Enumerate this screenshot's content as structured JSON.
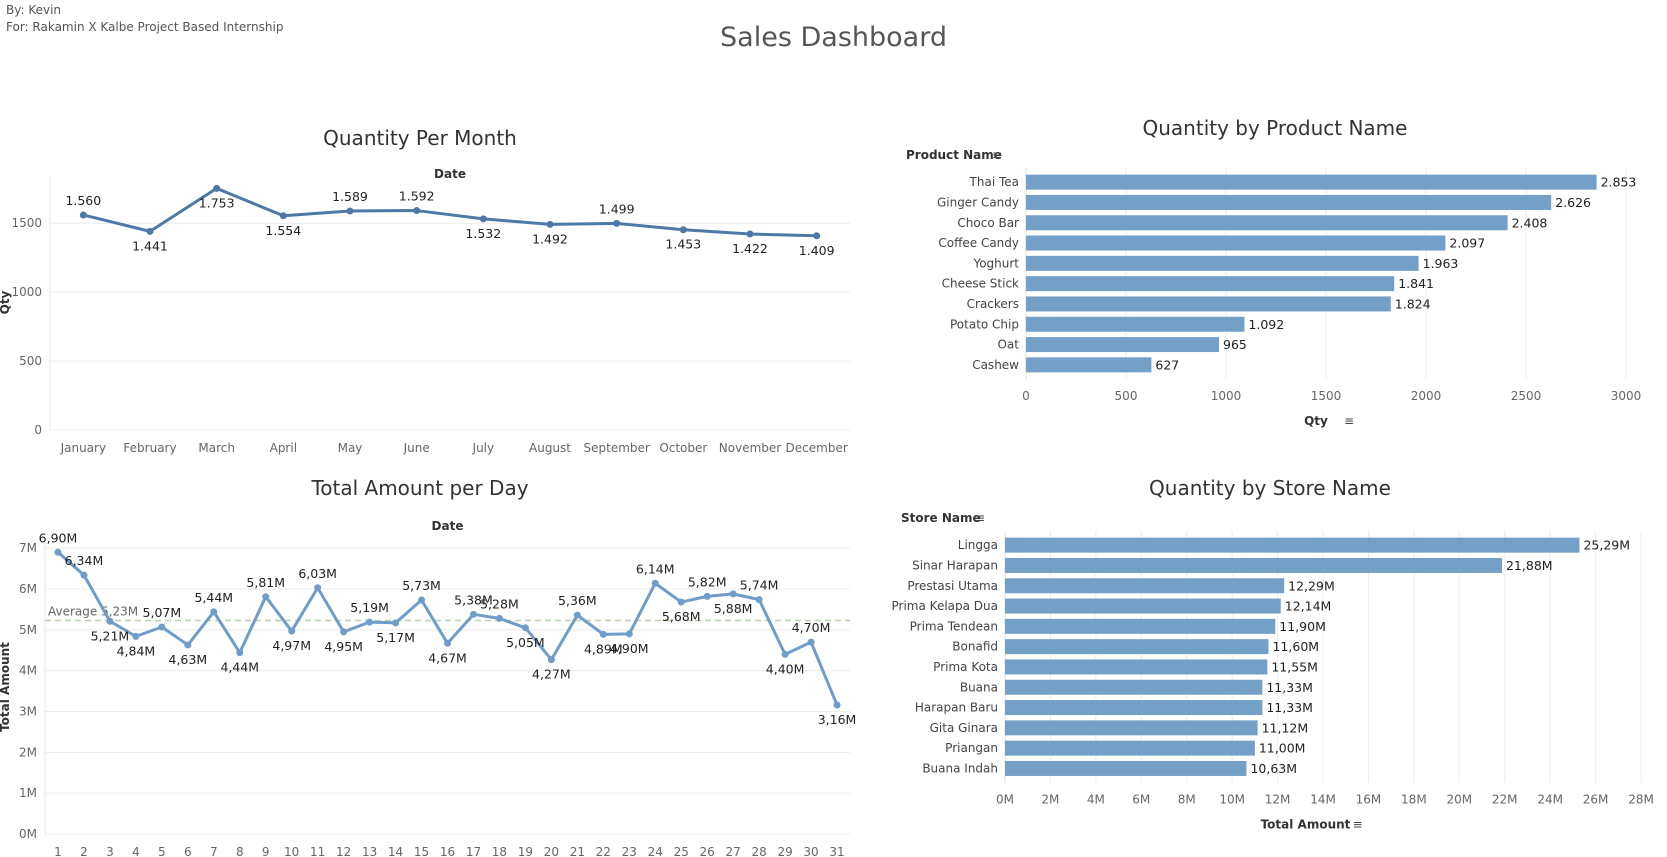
{
  "header": {
    "credit_by": "By: Kevin",
    "credit_for": "For: Rakamin X Kalbe Project Based Internship",
    "title": "Sales Dashboard"
  },
  "colors": {
    "month_line": "#4e79a7",
    "day_line": "#6f9cc9",
    "bar": "#74a0c8",
    "average_line": "#b9d2b2",
    "grid": "#ececec",
    "axis_text": "#666666"
  },
  "chart_data": [
    {
      "id": "qty_month",
      "type": "line",
      "title": "Quantity Per Month",
      "column_header": "Date",
      "ylabel": "Qty",
      "categories": [
        "January",
        "February",
        "March",
        "April",
        "May",
        "June",
        "July",
        "August",
        "September",
        "October",
        "November",
        "December"
      ],
      "values": [
        1560,
        1441,
        1753,
        1554,
        1589,
        1592,
        1532,
        1492,
        1499,
        1453,
        1422,
        1409
      ],
      "labels": [
        "1.560",
        "1.441",
        "1.753",
        "1.554",
        "1.589",
        "1.592",
        "1.532",
        "1.492",
        "1.499",
        "1.453",
        "1.422",
        "1.409"
      ],
      "y_ticks": [
        0,
        500,
        1000,
        1500
      ],
      "ylim": [
        0,
        1850
      ],
      "grid": true
    },
    {
      "id": "qty_product",
      "type": "bar",
      "orientation": "horizontal",
      "title": "Quantity by Product Name",
      "row_header": "Product Name",
      "xlabel": "Qty",
      "categories": [
        "Thai Tea",
        "Ginger Candy",
        "Choco Bar",
        "Coffee Candy",
        "Yoghurt",
        "Cheese Stick",
        "Crackers",
        "Potato Chip",
        "Oat",
        "Cashew"
      ],
      "values": [
        2853,
        2626,
        2408,
        2097,
        1963,
        1841,
        1824,
        1092,
        965,
        627
      ],
      "labels": [
        "2.853",
        "2.626",
        "2.408",
        "2.097",
        "1.963",
        "1.841",
        "1.824",
        "1.092",
        "965",
        "627"
      ],
      "x_ticks": [
        0,
        500,
        1000,
        1500,
        2000,
        2500,
        3000
      ],
      "xlim": [
        0,
        3200
      ],
      "grid": true
    },
    {
      "id": "amount_day",
      "type": "line",
      "title": "Total Amount per Day",
      "column_header": "Date",
      "ylabel": "Total Amount",
      "categories": [
        "1",
        "2",
        "3",
        "4",
        "5",
        "6",
        "7",
        "8",
        "9",
        "10",
        "11",
        "12",
        "13",
        "14",
        "15",
        "16",
        "17",
        "18",
        "19",
        "20",
        "21",
        "22",
        "23",
        "24",
        "25",
        "26",
        "27",
        "28",
        "29",
        "30",
        "31"
      ],
      "values": [
        6.9,
        6.34,
        5.21,
        4.84,
        5.07,
        4.63,
        5.44,
        4.44,
        5.81,
        4.97,
        6.03,
        4.95,
        5.19,
        5.17,
        5.73,
        4.67,
        5.38,
        5.28,
        5.05,
        4.27,
        5.36,
        4.89,
        4.9,
        6.14,
        5.68,
        5.82,
        5.88,
        5.74,
        4.4,
        4.7,
        3.16
      ],
      "labels": [
        "6,90M",
        "6,34M",
        "5,21M",
        "4,84M",
        "5,07M",
        "4,63M",
        "5,44M",
        "4,44M",
        "5,81M",
        "4,97M",
        "6,03M",
        "4,95M",
        "5,19M",
        "5,17M",
        "5,73M",
        "4,67M",
        "5,38M",
        "5,28M",
        "5,05M",
        "4,27M",
        "5,36M",
        "4,89M",
        "4,90M",
        "6,14M",
        "5,68M",
        "5,82M",
        "5,88M",
        "5,74M",
        "4,40M",
        "4,70M",
        "3,16M"
      ],
      "label_above": [
        true,
        true,
        false,
        false,
        true,
        false,
        true,
        false,
        true,
        false,
        true,
        false,
        true,
        false,
        true,
        false,
        true,
        true,
        false,
        false,
        true,
        false,
        false,
        true,
        false,
        true,
        false,
        true,
        false,
        true,
        false
      ],
      "y_ticks": [
        0,
        1,
        2,
        3,
        4,
        5,
        6,
        7
      ],
      "y_tick_labels": [
        "0M",
        "1M",
        "2M",
        "3M",
        "4M",
        "5M",
        "6M",
        "7M"
      ],
      "ylim": [
        0,
        7.2
      ],
      "unit": "M",
      "average": 5.23,
      "average_label": "Average 5,23M",
      "grid": true
    },
    {
      "id": "qty_store",
      "type": "bar",
      "orientation": "horizontal",
      "title": "Quantity by Store Name",
      "row_header": "Store Name",
      "xlabel": "Total Amount",
      "categories": [
        "Lingga",
        "Sinar Harapan",
        "Prestasi Utama",
        "Prima Kelapa Dua",
        "Prima Tendean",
        "Bonafid",
        "Prima Kota",
        "Buana",
        "Harapan Baru",
        "Gita Ginara",
        "Priangan",
        "Buana Indah"
      ],
      "values": [
        25.29,
        21.88,
        12.29,
        12.14,
        11.9,
        11.6,
        11.55,
        11.33,
        11.33,
        11.12,
        11.0,
        10.63
      ],
      "labels": [
        "25,29M",
        "21,88M",
        "12,29M",
        "12,14M",
        "11,90M",
        "11,60M",
        "11,55M",
        "11,33M",
        "11,33M",
        "11,12M",
        "11,00M",
        "10,63M"
      ],
      "x_ticks": [
        0,
        2,
        4,
        6,
        8,
        10,
        12,
        14,
        16,
        18,
        20,
        22,
        24,
        26,
        28
      ],
      "x_tick_labels": [
        "0M",
        "2M",
        "4M",
        "6M",
        "8M",
        "10M",
        "12M",
        "14M",
        "16M",
        "18M",
        "20M",
        "22M",
        "24M",
        "26M",
        "28M"
      ],
      "xlim": [
        0,
        29.1
      ],
      "grid": true
    }
  ]
}
